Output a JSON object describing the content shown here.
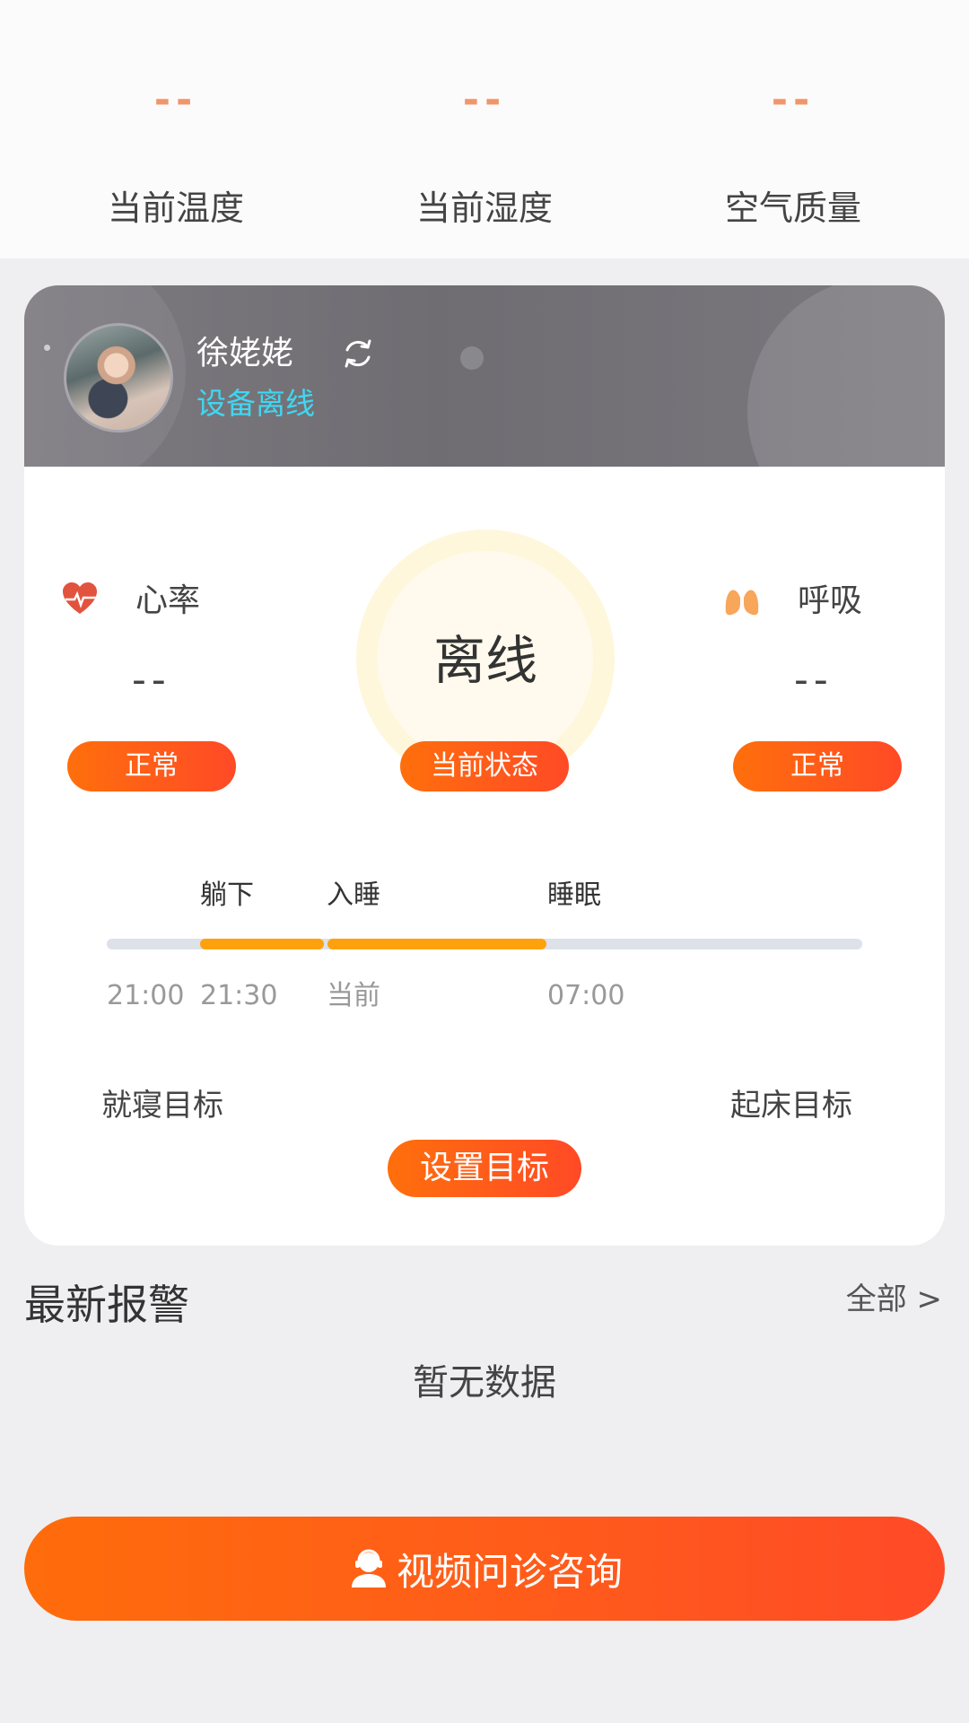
{
  "env": {
    "temperature": {
      "value": "--",
      "label": "当前温度"
    },
    "humidity": {
      "value": "--",
      "label": "当前湿度"
    },
    "air": {
      "value": "--",
      "label": "空气质量"
    }
  },
  "profile": {
    "name": "徐姥姥",
    "device_status": "设备离线",
    "status_color": "#3fd7f2"
  },
  "metrics": {
    "heart_rate": {
      "label": "心率",
      "value": "--",
      "badge": "正常",
      "icon": "heart-icon"
    },
    "state": {
      "value": "离线",
      "badge": "当前状态"
    },
    "breathing": {
      "label": "呼吸",
      "value": "--",
      "badge": "正常",
      "icon": "lungs-icon"
    }
  },
  "sleep_timeline": {
    "labels": {
      "lie_down": "躺下",
      "fall_asleep": "入睡",
      "sleep": "睡眠"
    },
    "times": {
      "start": "21:00",
      "lie_down": "21:30",
      "now": "当前",
      "wake": "07:00"
    },
    "progress_color": "#ffa10d"
  },
  "goals": {
    "bedtime_label": "就寝目标",
    "wake_label": "起床目标",
    "set_button": "设置目标"
  },
  "alarms": {
    "title": "最新报警",
    "all_link": "全部 >",
    "empty_text": "暂无数据"
  },
  "consult_button": "视频问诊咨询",
  "colors": {
    "accent": "#ff5a1c",
    "accent_light": "#ff6f0c"
  }
}
